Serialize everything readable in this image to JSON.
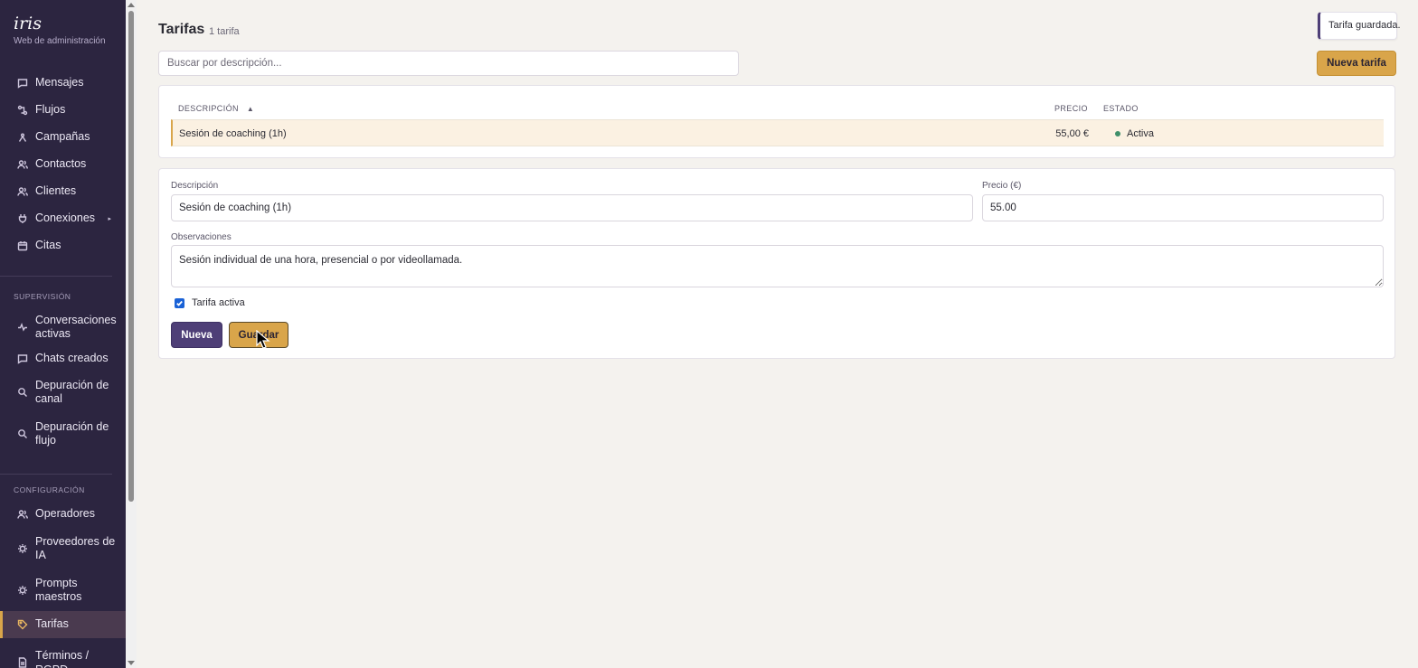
{
  "app": {
    "brand": "iris",
    "subtitle": "Web de administración"
  },
  "sidebar": {
    "main_items": [
      {
        "label": "Mensajes",
        "icon": "message-icon"
      },
      {
        "label": "Flujos",
        "icon": "flow-icon"
      },
      {
        "label": "Campañas",
        "icon": "megaphone-icon"
      },
      {
        "label": "Contactos",
        "icon": "contacts-icon"
      },
      {
        "label": "Clientes",
        "icon": "clients-icon"
      },
      {
        "label": "Conexiones",
        "icon": "plug-icon",
        "caret": "▸"
      },
      {
        "label": "Citas",
        "icon": "calendar-icon"
      }
    ],
    "supervision_title": "SUPERVISIÓN",
    "supervision_items": [
      {
        "label": "Conversaciones activas",
        "icon": "activity-icon"
      },
      {
        "label": "Chats creados",
        "icon": "chat-icon"
      },
      {
        "label": "Depuración de canal",
        "icon": "search-icon"
      },
      {
        "label": "Depuración de flujo",
        "icon": "search-icon"
      }
    ],
    "config_title": "CONFIGURACIÓN",
    "config_items": [
      {
        "label": "Operadores",
        "icon": "operators-icon"
      },
      {
        "label": "Proveedores de IA",
        "icon": "chip-icon"
      },
      {
        "label": "Prompts maestros",
        "icon": "chip-icon"
      },
      {
        "label": "Tarifas",
        "icon": "tag-icon",
        "active": true
      },
      {
        "label": "Términos / RGPD",
        "icon": "document-icon"
      }
    ]
  },
  "header": {
    "title": "Tarifas",
    "count": "1 tarifa",
    "toast": "Tarifa guardada."
  },
  "search": {
    "placeholder": "Buscar por descripción...",
    "value": ""
  },
  "toolbar": {
    "new_rate_label": "Nueva tarifa"
  },
  "table": {
    "columns": {
      "description": "DESCRIPCIÓN",
      "sort_indicator": "▲",
      "price": "PRECIO",
      "status": "ESTADO"
    },
    "rows": [
      {
        "description": "Sesión de coaching (1h)",
        "price": "55,00 €",
        "status": "Activa",
        "status_color": "#3f8f6a"
      }
    ]
  },
  "form": {
    "description_label": "Descripción",
    "description_value": "Sesión de coaching (1h)",
    "price_label": "Precio (€)",
    "price_value": "55.00",
    "notes_label": "Observaciones",
    "notes_value": "Sesión individual de una hora, presencial o por videollamada.",
    "active_label": "Tarifa activa",
    "active_checked": true,
    "new_label": "Nueva",
    "save_label": "Guardar"
  },
  "colors": {
    "sidebar_bg": "#2c2540",
    "accent_gold": "#d9a54a",
    "accent_purple": "#4e3f77",
    "status_active": "#3f8f6a"
  }
}
